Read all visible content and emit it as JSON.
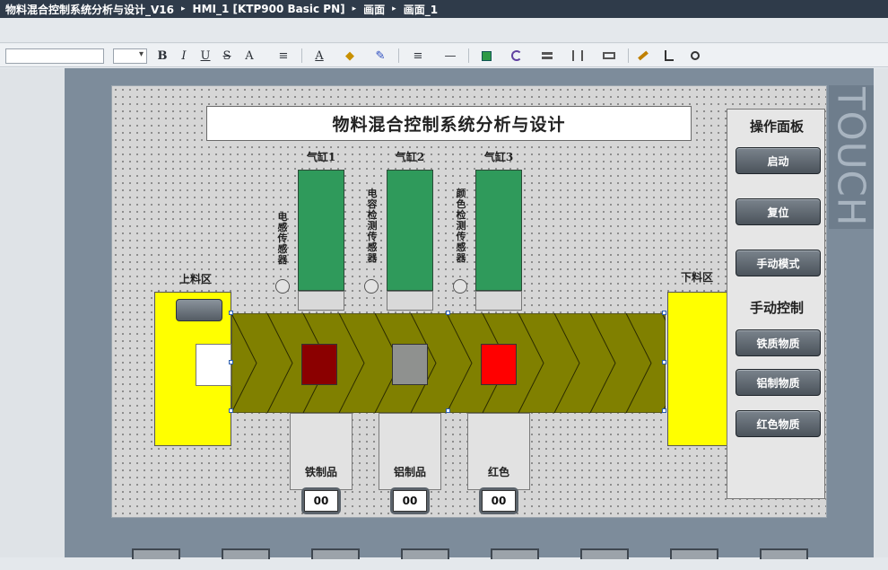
{
  "breadcrumb": [
    "物料混合控制系统分析与设计_V16",
    "HMI_1 [KTP900 Basic PN]",
    "画面",
    "画面_1"
  ],
  "breadcrumb_separator": "▸",
  "toolbar": {
    "font_name_value": "",
    "font_size_value": "",
    "bold": "B",
    "italic": "I",
    "underline": "U",
    "strike": "S",
    "grow_font": "A",
    "align": "≡",
    "font_color": "A",
    "fill": "◆",
    "pen": "✎",
    "line_width": "≡",
    "line_style": "—",
    "dropdown_arrow": "▾"
  },
  "touch_label": "TOUCH",
  "hmi": {
    "title": "物料混合控制系统分析与设计",
    "cylinders": [
      {
        "label": "气缸1"
      },
      {
        "label": "气缸2"
      },
      {
        "label": "气缸3"
      }
    ],
    "sensors": [
      {
        "label": "电感传感器"
      },
      {
        "label": "电容检测传感器"
      },
      {
        "label": "颜色检测传感器"
      }
    ],
    "zones": {
      "load": "上料区",
      "unload": "下料区"
    },
    "items": [
      {
        "color": "#8b0000"
      },
      {
        "color": "#8f918f"
      },
      {
        "color": "#ff0000"
      }
    ],
    "conveyor_color": "#808000",
    "bins": [
      {
        "label": "铁制品",
        "count": "00"
      },
      {
        "label": "铝制品",
        "count": "00"
      },
      {
        "label": "红色",
        "count": "00"
      }
    ],
    "control_panel": {
      "header_ops": "操作面板",
      "start": "启动",
      "reset": "复位",
      "manual_mode": "手动模式",
      "header_manual": "手动控制",
      "iron": "铁质物质",
      "aluminum": "铝制物质",
      "red": "红色物质"
    }
  }
}
